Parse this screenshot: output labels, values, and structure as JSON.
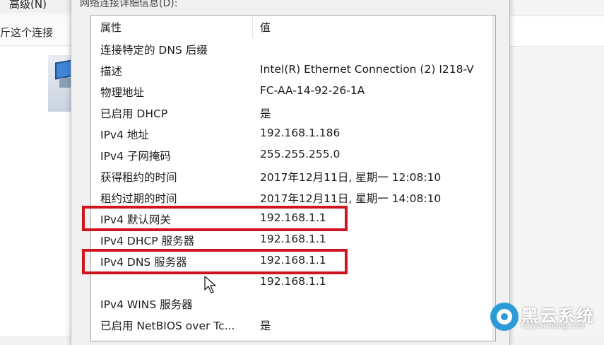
{
  "background_window": {
    "menu_item": "高级(N)",
    "toolbar_item": "斤这个连接"
  },
  "dialog": {
    "details_label": "网络连接详细信息(D):",
    "columns": {
      "property": "属性",
      "value": "值"
    },
    "rows": [
      {
        "property": "连接特定的 DNS 后缀",
        "value": ""
      },
      {
        "property": "描述",
        "value": "Intel(R) Ethernet Connection (2) I218-V"
      },
      {
        "property": "物理地址",
        "value": "FC-AA-14-92-26-1A"
      },
      {
        "property": "已启用 DHCP",
        "value": "是"
      },
      {
        "property": "IPv4 地址",
        "value": "192.168.1.186"
      },
      {
        "property": "IPv4 子网掩码",
        "value": "255.255.255.0"
      },
      {
        "property": "获得租约的时间",
        "value": "2017年12月11日, 星期一 12:08:10"
      },
      {
        "property": "租约过期的时间",
        "value": "2017年12月11日, 星期一 14:08:10"
      },
      {
        "property": "IPv4 默认网关",
        "value": "192.168.1.1"
      },
      {
        "property": "IPv4 DHCP 服务器",
        "value": "192.168.1.1"
      },
      {
        "property": "IPv4 DNS 服务器",
        "value": "192.168.1.1"
      },
      {
        "property": "",
        "value": "192.168.1.1"
      },
      {
        "property": "IPv4 WINS 服务器",
        "value": ""
      },
      {
        "property": "已启用 NetBIOS over Tc...",
        "value": "是"
      }
    ]
  },
  "highlight_color": "#d2121f",
  "watermark": {
    "title": "黑云系统",
    "url": "heiyunxitong.com"
  }
}
